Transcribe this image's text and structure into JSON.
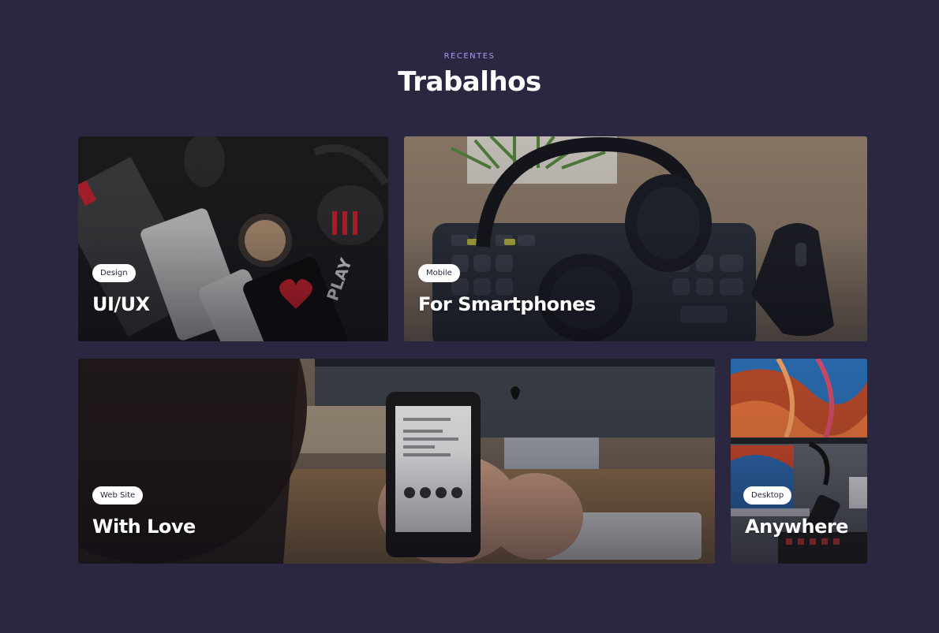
{
  "section": {
    "eyebrow": "RECENTES",
    "title": "Trabalhos"
  },
  "cards": [
    {
      "tag": "Design",
      "title": "UI/UX",
      "image": "flat-lay-desk-accessories-photo"
    },
    {
      "tag": "Mobile",
      "title": "For Smartphones",
      "image": "headphones-keyboard-mouse-photo"
    },
    {
      "tag": "Web Site",
      "title": "With Love",
      "image": "hands-holding-smartphone-photo"
    },
    {
      "tag": "Desktop",
      "title": "Anywhere",
      "image": "desktop-monitor-laptop-photo"
    }
  ],
  "colors": {
    "background": "#2b2740",
    "eyebrow": "#a79bf2",
    "title": "#ffffff",
    "tag_bg": "#ffffff",
    "tag_text": "#2b2740"
  }
}
